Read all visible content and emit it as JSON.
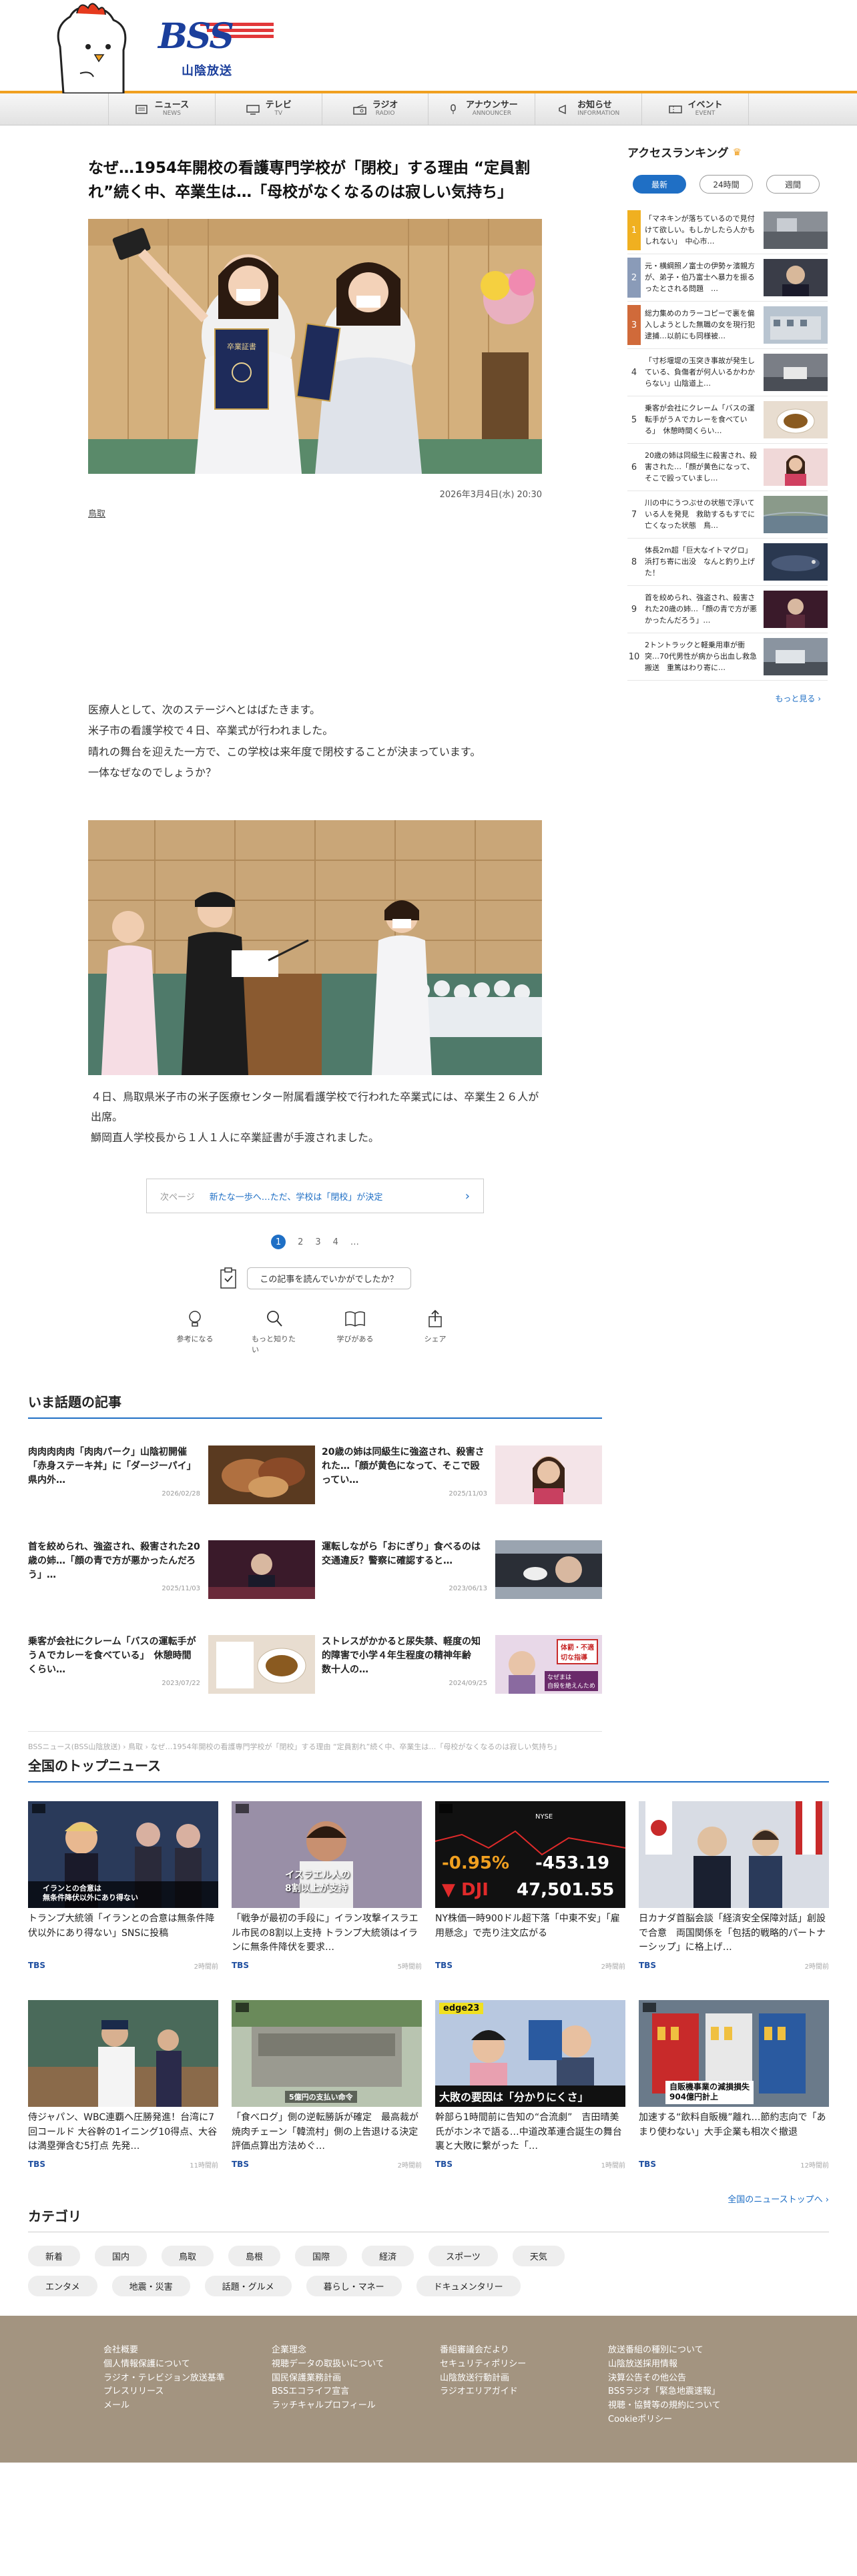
{
  "header": {
    "logo_text": "BSS",
    "logo_sub": "山陰放送",
    "nav": [
      {
        "jp": "ニュース",
        "en": "NEWS",
        "icon": "newspaper-icon"
      },
      {
        "jp": "テレビ",
        "en": "TV",
        "icon": "tv-icon"
      },
      {
        "jp": "ラジオ",
        "en": "RADIO",
        "icon": "radio-icon"
      },
      {
        "jp": "アナウンサー",
        "en": "ANNOUNCER",
        "icon": "microphone-icon"
      },
      {
        "jp": "お知らせ",
        "en": "INFORMATION",
        "icon": "megaphone-icon"
      },
      {
        "jp": "イベント",
        "en": "EVENT",
        "icon": "ticket-icon"
      }
    ]
  },
  "article": {
    "title": "なぜ…1954年開校の看護専門学校が「閉校」する理由 “定員割れ”続く中、卒業生は…「母校がなくなるのは寂しい気持ち」",
    "date": "2026年3月4日(水) 20:30",
    "author": "鳥取",
    "body": [
      "医療人として、次のステージへとはばたきます。",
      "米子市の看護学校で４日、卒業式が行われました。",
      "晴れの舞台を迎えた一方で、この学校は来年度で閉校することが決まっています。",
      "一体なぜなのでしょうか？"
    ],
    "caption": [
      "４日、鳥取県米子市の米子医療センター附属看護学校で行われた卒業式には、卒業生２６人が出席。",
      "鰤岡直人学校長から１人１人に卒業証書が手渡されました。"
    ],
    "hero_text": "卒業証書",
    "next_label": "次ページ",
    "next_title": "新たな一歩へ…ただ、学校は「閉校」が決定",
    "pages": [
      "1",
      "2",
      "3",
      "4",
      "…"
    ],
    "survey_label": "この記事を読んでいかがでしたか？",
    "reactions": [
      {
        "label": "参考になる",
        "icon": "lightbulb-icon"
      },
      {
        "label": "もっと知りたい",
        "icon": "magnifier-icon"
      },
      {
        "label": "学びがある",
        "icon": "book-icon"
      },
      {
        "label": "シェア",
        "icon": "share-icon"
      }
    ]
  },
  "ranking": {
    "title": "アクセスランキング",
    "tabs": [
      "最新",
      "24時間",
      "週間"
    ],
    "items": [
      {
        "num": "1",
        "text": "「マネキンが落ちているので見付けて欲しい。もしかしたら人かもしれない」　中心市…"
      },
      {
        "num": "2",
        "text": "元・横綱照ノ富士の伊勢ヶ濱親方が、弟子・伯乃富士へ暴力を振るったとされる問題　…"
      },
      {
        "num": "3",
        "text": "総力集めのカラーコピーで裏を偏入しようとした無職の女を現行犯逮捕…以前にも同様被…"
      },
      {
        "num": "4",
        "text": "「寸杉堰堤の玉突き事故が発生している、負傷者が何人いるかわからない」山陰道上…"
      },
      {
        "num": "5",
        "text": "乗客が会社にクレーム「バスの運転手がうＡでカレーを食べている」　休憩時間くらい…"
      },
      {
        "num": "6",
        "text": "20歳の姉は同級生に殺害され、殺害された…「顔が黄色になって、そこで殴っていまし…"
      },
      {
        "num": "7",
        "text": "川の中にうつぶせの状態で浮いている人を発見　救助するもすでに亡くなった状態　鳥…"
      },
      {
        "num": "8",
        "text": "体長2m超「巨大なイトマグロ」浜打ち寄に出没　なんと釣り上げた！"
      },
      {
        "num": "9",
        "text": "首を絞められ、強盗され、殺害された20歳の姉…「顔の青で方が悪かったんだろう」…"
      },
      {
        "num": "10",
        "text": "2トントラックと軽乗用車が衝突…70代男性が病から出血し救急搬送　重篤はわり寄に…"
      }
    ],
    "more": "もっと見る"
  },
  "trending": {
    "title": "いま話題の記事",
    "items": [
      {
        "title": "肉肉肉肉肉「肉肉パーク」山陰初開催「赤身ステーキ丼」に「ダージーパイ」県内外…",
        "date": "2026/02/28"
      },
      {
        "title": "20歳の姉は同級生に強盗され、殺害された…「顔が黄色になって、そこで殴ってい…",
        "date": "2025/11/03"
      },
      {
        "title": "首を絞められ、強盗され、殺害された20歳の姉…「顔の青で方が悪かったんだろう」…",
        "date": "2025/11/03"
      },
      {
        "title": "運転しながら「おにぎり」食べるのは交通違反？警察に確認すると…",
        "date": "2023/06/13"
      },
      {
        "title": "乗客が会社にクレーム「バスの運転手がうＡでカレーを食べている」　休憩時間くらい…",
        "date": "2023/07/22"
      },
      {
        "title": "ストレスがかかると尿失禁、軽度の知的障害で小学４年生程度の精神年齢　数十人の…",
        "date": "2024/09/25"
      }
    ],
    "thumb_overlay": [
      "体罰・不適\n切な指導",
      "なぜまは\n自殺を絶えんため"
    ]
  },
  "breadcrumb": "BSSニュース(BSS山陰放送) › 鳥取 › なぜ…1954年開校の看護専門学校が「閉校」する理由 “定員割れ”続く中、卒業生は…「母校がなくなるのは寂しい気持ち」",
  "topnews": {
    "title": "全国のトップニュース",
    "items": [
      {
        "title": "トランプ大統領「イランとの合意は無条件降伏以外にあり得ない」SNSに投稿",
        "src": "TBS",
        "time": "2時間前",
        "overlay": "イランとの合意は\n無条件降伏以外にあり得ない"
      },
      {
        "title": "「戦争が最初の手段に」イラン攻撃イスラエル市民の8割以上支持 トランプ大統領はイランに無条件降伏を要求…",
        "src": "TBS",
        "time": "5時間前",
        "overlay": "イスラエル人の\n8割以上が支持"
      },
      {
        "title": "NY株価一時900ドル超下落「中東不安」「雇用懸念」で売り注文広がる",
        "src": "TBS",
        "time": "2時間前",
        "overlay": ""
      },
      {
        "title": "日カナダ首脳会談「経済安全保障対話」創設で合意　両国関係を「包括的戦略的パートナーシップ」に格上げ…",
        "src": "TBS",
        "time": "2時間前",
        "overlay": ""
      },
      {
        "title": "侍ジャパン、WBC連覇へ圧勝発進！台湾に7回コールド 大谷幹の1イニング10得点、大谷は満塁弾含む5打点 先発…",
        "src": "TBS",
        "time": "11時間前",
        "overlay": ""
      },
      {
        "title": "「食べログ」側の逆転勝訴が確定　最高裁が焼肉チェーン「韓流村」側の上告退ける決定　評価点算出方法めぐ…",
        "src": "TBS",
        "time": "2時間前",
        "overlay": "5億円の支払い命令"
      },
      {
        "title": "幹部ら1時間前に告知の“合流劇”　吉田晴美氏がホンネで語る…中道改革連合誕生の舞台裏と大敗に繋がった「…",
        "src": "TBS",
        "time": "1時間前",
        "overlay": "大敗の要因は「分かりにくさ」"
      },
      {
        "title": "加速する“飲料自販機”離れ…節約志向で「あまり使わない」大手企業も相次ぐ撤退",
        "src": "TBS",
        "time": "12時間前",
        "overlay": "自販機事業の減損損失\n904億円計上"
      }
    ],
    "market": {
      "pct": "-0.95%",
      "diff": "-453.19",
      "name": "DJI",
      "value": "47,501.55",
      "label": "NYSE"
    },
    "edge": "edge23",
    "more": "全国のニューストップへ"
  },
  "categories": {
    "title": "カテゴリ",
    "tags": [
      "新着",
      "国内",
      "鳥取",
      "島根",
      "国際",
      "経済",
      "スポーツ",
      "天気",
      "エンタメ",
      "地震・災害",
      "話題・グルメ",
      "暮らし・マネー",
      "ドキュメンタリー"
    ]
  },
  "footer": {
    "cols": [
      [
        "会社概要",
        "個人情報保護について",
        "ラジオ・テレビジョン放送基準",
        "プレスリリース",
        "メール"
      ],
      [
        "企業理念",
        "視聴データの取扱いについて",
        "国民保護業務計画",
        "BSSエコライフ宣言",
        "ラッチキャルプロフィール"
      ],
      [
        "番組審議会だより",
        "セキュリティポリシー",
        "山陰放送行動計画",
        "ラジオエリアガイド"
      ],
      [
        "放送番組の種別について",
        "山陰放送採用情報",
        "決算公告その他公告",
        "BSSラジオ「緊急地震速報」",
        "視聴・協賛等の規約について",
        "Cookieポリシー"
      ]
    ]
  },
  "colors": {
    "accent": "#1f6fc5",
    "header_orange": "#f0a020",
    "footer": "#a39480",
    "logo_blue": "#1b3f9c"
  }
}
